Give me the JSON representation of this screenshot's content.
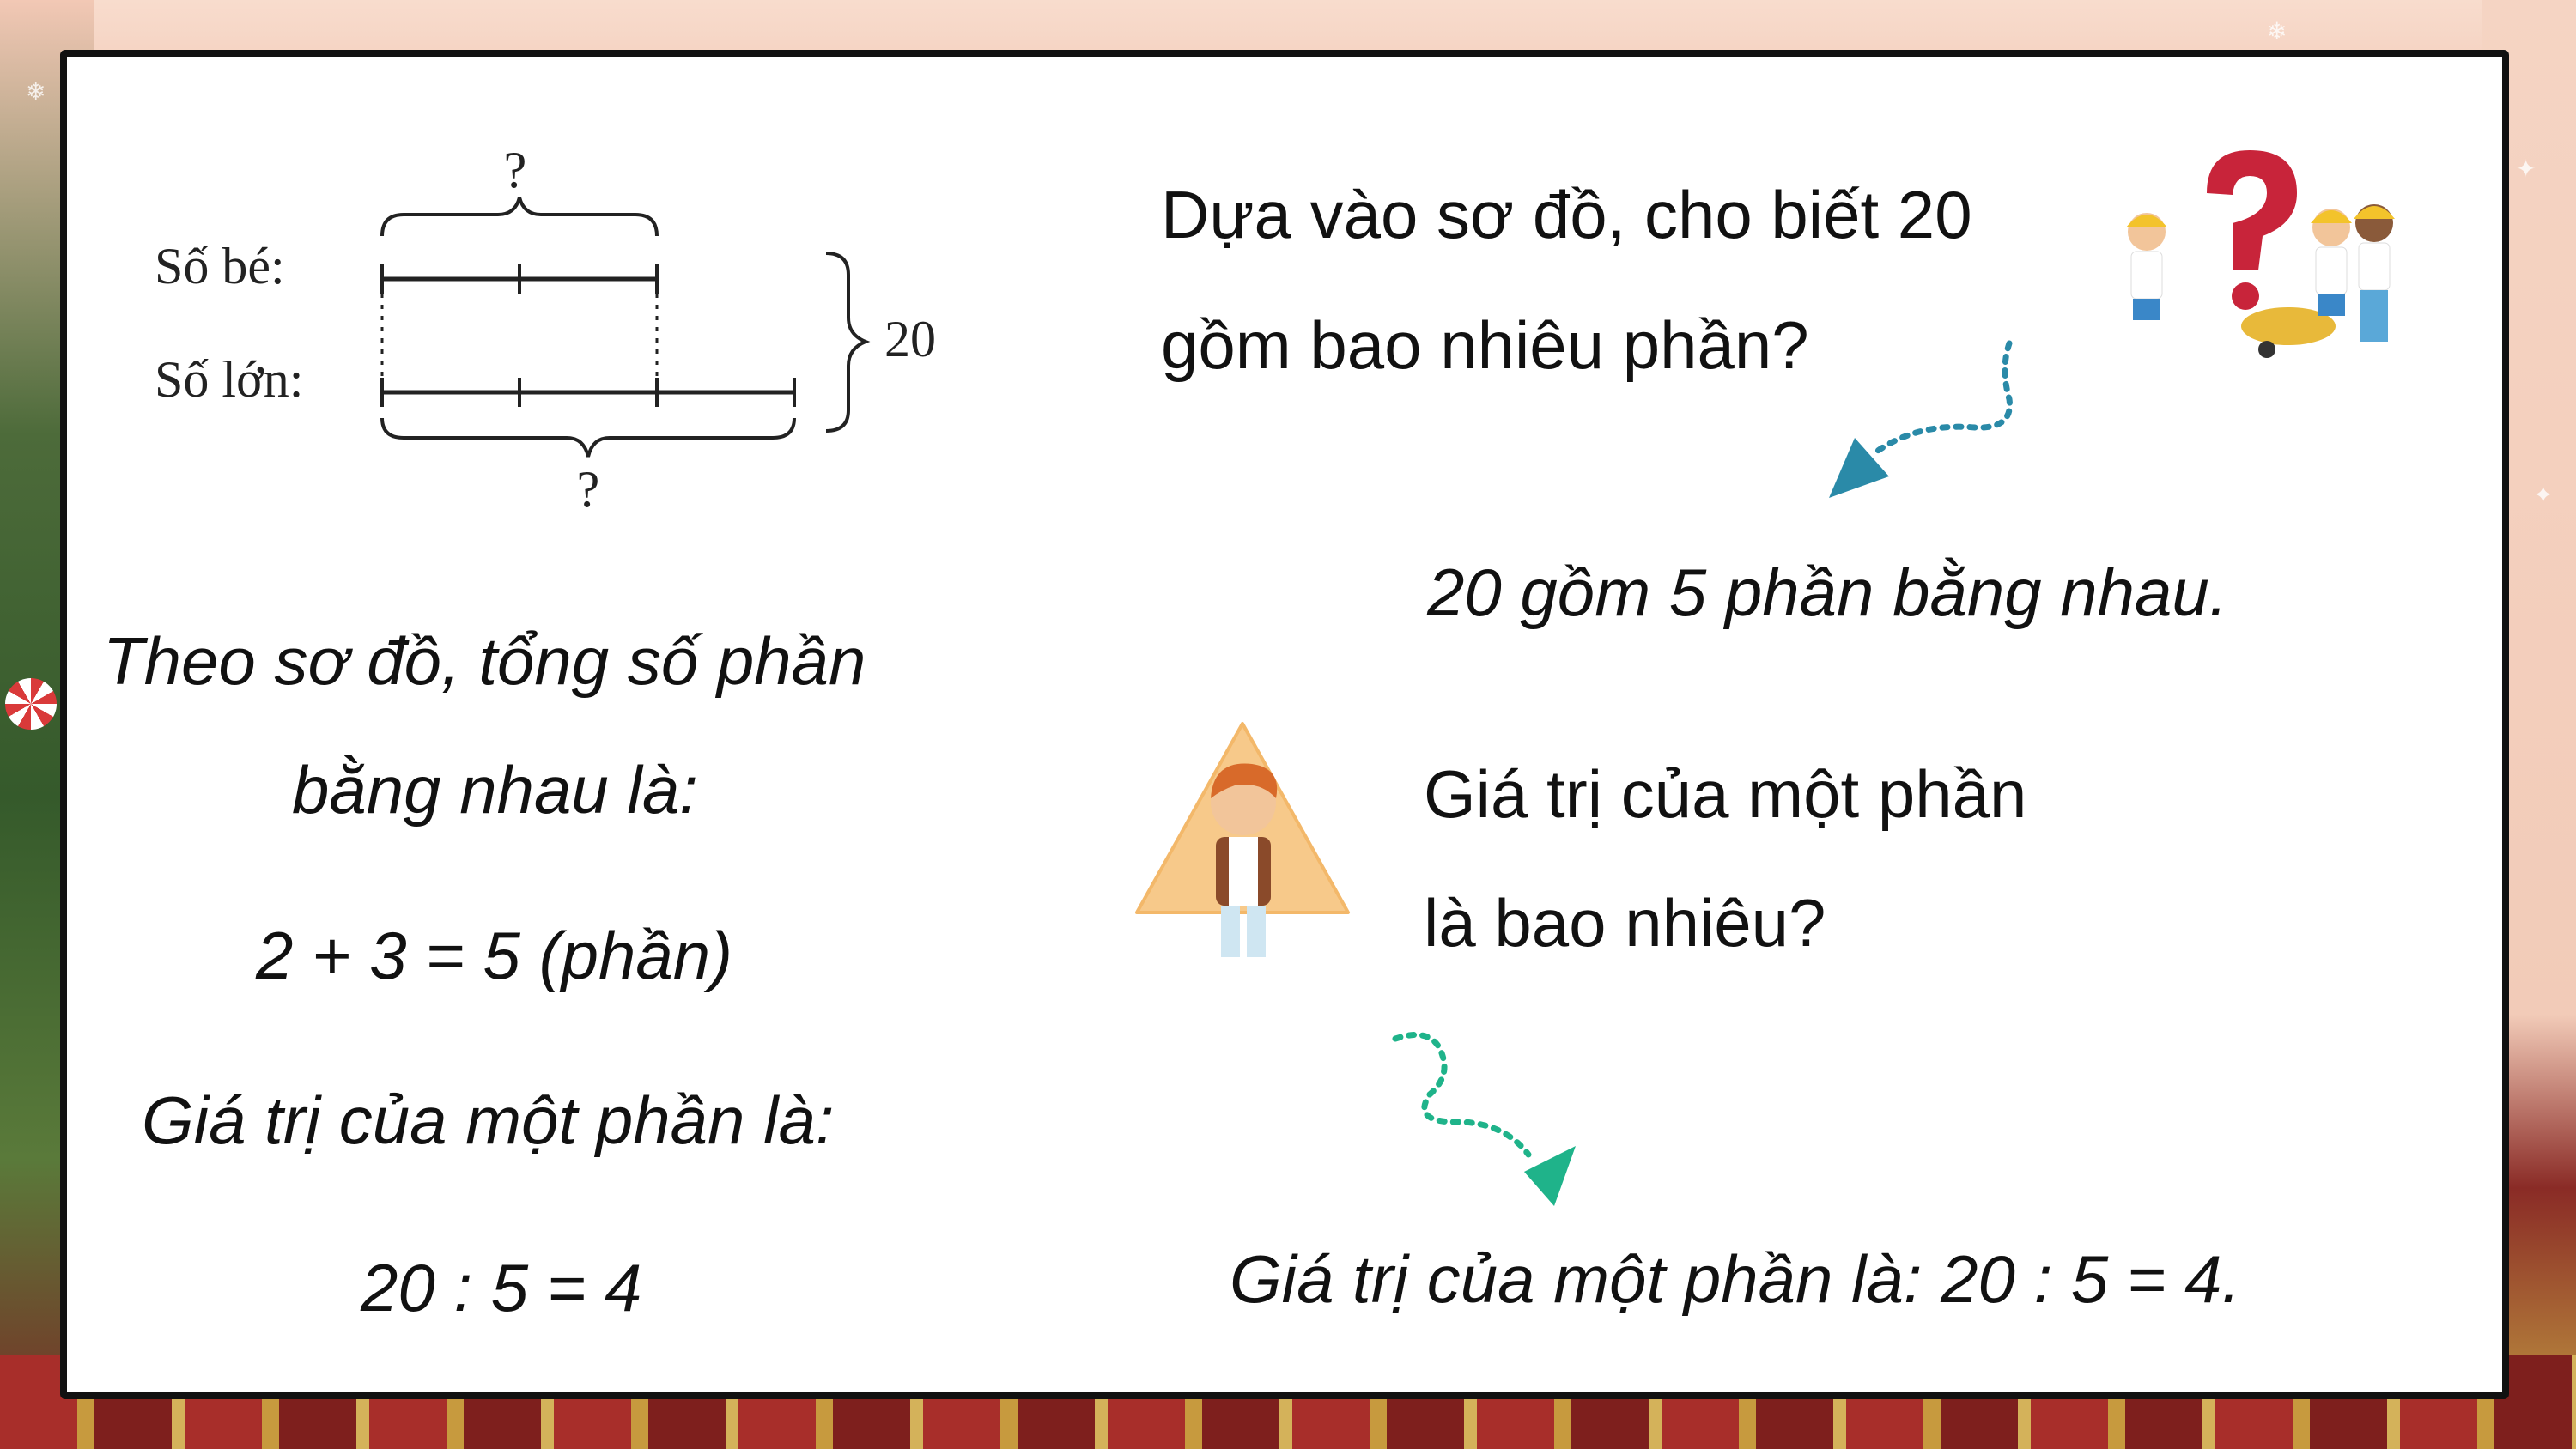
{
  "diagram": {
    "small_label": "Số bé:",
    "large_label": "Số lớn:",
    "total": "20",
    "top_question": "?",
    "bottom_question": "?"
  },
  "right": {
    "question1_line1": "Dựa vào sơ đồ, cho biết 20",
    "question1_line2": "gồm bao nhiêu phần?",
    "answer1": "20 gồm 5 phần bằng nhau.",
    "question2_line1": "Giá trị của một phần",
    "question2_line2": "là bao nhiêu?",
    "answer2": "Giá trị của một phần là: 20 : 5 = 4."
  },
  "left": {
    "line1": "Theo sơ đồ, tổng số phần",
    "line2": "bằng nhau là:",
    "line3": "2 + 3 = 5 (phần)",
    "line4": "Giá trị của một phần là:",
    "line5": "20 : 5 = 4"
  },
  "icons": {
    "kids": "kids-question-icon",
    "thinking_boy": "thinking-boy-icon",
    "arrow_blue": "arrow-blue-icon",
    "arrow_green": "arrow-green-icon"
  },
  "colors": {
    "arrow_blue": "#2a8aa8",
    "arrow_green": "#1fb38a",
    "question_mark": "#c8243a",
    "triangle": "#f7c98a"
  }
}
